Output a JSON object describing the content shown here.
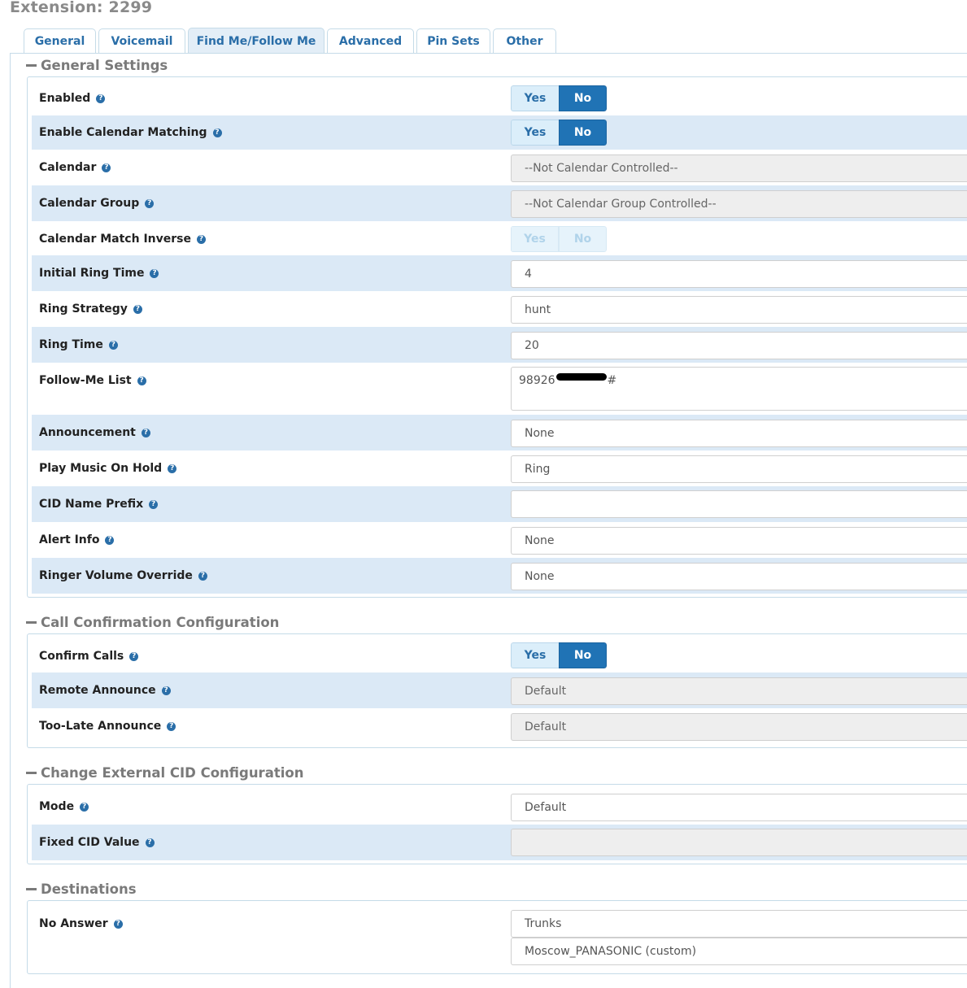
{
  "header": {
    "title": "Extension: 2299"
  },
  "tabs": [
    {
      "label": "General"
    },
    {
      "label": "Voicemail"
    },
    {
      "label": "Find Me/Follow Me",
      "active": true
    },
    {
      "label": "Advanced"
    },
    {
      "label": "Pin Sets"
    },
    {
      "label": "Other"
    }
  ],
  "icons": {
    "help": "question-circle-icon",
    "collapse": "minus-icon"
  },
  "colors": {
    "accent": "#2073b5",
    "row_shade": "#dbe9f6",
    "tab_text": "#2a6ea8",
    "section_title": "#7a7a7a"
  },
  "sections": {
    "general": {
      "title": "General Settings",
      "enabled": {
        "label": "Enabled",
        "yes": "Yes",
        "no": "No",
        "value": "No"
      },
      "calendar_matching": {
        "label": "Enable Calendar Matching",
        "yes": "Yes",
        "no": "No",
        "value": "No"
      },
      "calendar": {
        "label": "Calendar",
        "value": "--Not Calendar Controlled--"
      },
      "calendar_group": {
        "label": "Calendar Group",
        "value": "--Not Calendar Group Controlled--"
      },
      "calendar_match_inverse": {
        "label": "Calendar Match Inverse",
        "yes": "Yes",
        "no": "No"
      },
      "initial_ring_time": {
        "label": "Initial Ring Time",
        "value": "4"
      },
      "ring_strategy": {
        "label": "Ring Strategy",
        "value": "hunt"
      },
      "ring_time": {
        "label": "Ring Time",
        "value": "20"
      },
      "followme_list": {
        "label": "Follow-Me List",
        "value_prefix": "98926",
        "value_suffix": "#"
      },
      "announcement": {
        "label": "Announcement",
        "value": "None"
      },
      "music_on_hold": {
        "label": "Play Music On Hold",
        "value": "Ring"
      },
      "cid_name_prefix": {
        "label": "CID Name Prefix",
        "value": ""
      },
      "alert_info": {
        "label": "Alert Info",
        "value": "None"
      },
      "ringer_volume": {
        "label": "Ringer Volume Override",
        "value": "None"
      }
    },
    "call_confirmation": {
      "title": "Call Confirmation Configuration",
      "confirm_calls": {
        "label": "Confirm Calls",
        "yes": "Yes",
        "no": "No",
        "value": "No"
      },
      "remote_announce": {
        "label": "Remote Announce",
        "value": "Default"
      },
      "too_late_announce": {
        "label": "Too-Late Announce",
        "value": "Default"
      }
    },
    "external_cid": {
      "title": "Change External CID Configuration",
      "mode": {
        "label": "Mode",
        "value": "Default"
      },
      "fixed_cid": {
        "label": "Fixed CID Value",
        "value": ""
      }
    },
    "destinations": {
      "title": "Destinations",
      "no_answer": {
        "label": "No Answer",
        "type": "Trunks",
        "target": "Moscow_PANASONIC (custom)"
      }
    }
  }
}
